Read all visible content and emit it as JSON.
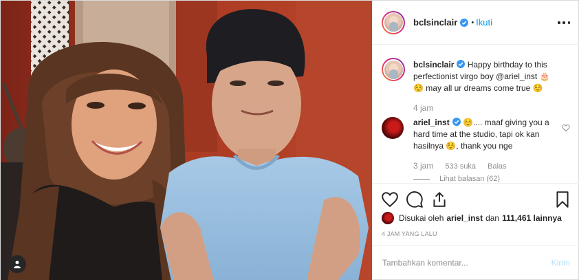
{
  "post": {
    "username": "bclsinclair",
    "dot": "•",
    "follow_label": "Ikuti"
  },
  "caption": {
    "username": "bclsinclair",
    "text": "Happy birthday to this perfectionist virgo boy @ariel_inst 🎂 ☺️ may all ur dreams come true ☺️",
    "time": "4 jam"
  },
  "comment": {
    "username": "ariel_inst",
    "text": "☺️.... maaf giving you a hard time at the studio, tapi ok kan hasilnya ☺️, thank you nge",
    "time": "3 jam",
    "likes": "533 suka",
    "reply_label": "Balas",
    "view_replies": "Lihat balasan (62)"
  },
  "likes": {
    "prefix": "Disukai oleh",
    "user": "ariel_inst",
    "connector": "dan",
    "count": "111,461 lainnya"
  },
  "posted_ago": "4 JAM YANG LALU",
  "add_comment": {
    "placeholder": "Tambahkan komentar...",
    "send_label": "Kirim"
  },
  "colors": {
    "accent": "#0095f6",
    "send_disabled": "#b2dffc",
    "muted": "#8e8e8e",
    "text": "#262626"
  },
  "icons": [
    "verified-badge-icon",
    "more-options-icon",
    "heart-icon",
    "comment-icon",
    "share-icon",
    "bookmark-icon",
    "user-tag-icon"
  ]
}
